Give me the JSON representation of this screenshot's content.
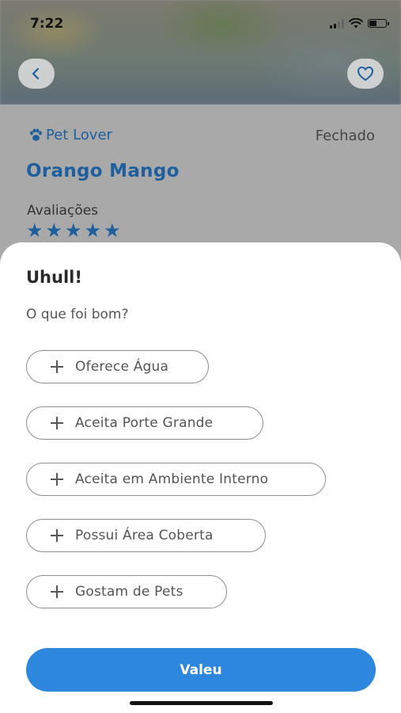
{
  "status_bar": {
    "time": "7:22"
  },
  "background": {
    "category": "Pet Lover",
    "status": "Fechado",
    "place_name": "Orango Mango",
    "ratings_label": "Avaliações",
    "stars": 5,
    "accent_color": "#1f5f9d"
  },
  "sheet": {
    "title": "Uhull!",
    "question": "O que foi bom?",
    "options": [
      {
        "label": "Oferece Água"
      },
      {
        "label": "Aceita Porte Grande"
      },
      {
        "label": "Aceita em Ambiente Interno"
      },
      {
        "label": "Possui Área Coberta"
      },
      {
        "label": "Gostam de Pets"
      }
    ],
    "submit_label": "Valeu",
    "button_color": "#2c87dd"
  },
  "icons": [
    "back-chevron-icon",
    "heart-icon",
    "paw-icon",
    "star-icon",
    "plus-icon",
    "signal-icon",
    "wifi-icon",
    "battery-icon"
  ]
}
